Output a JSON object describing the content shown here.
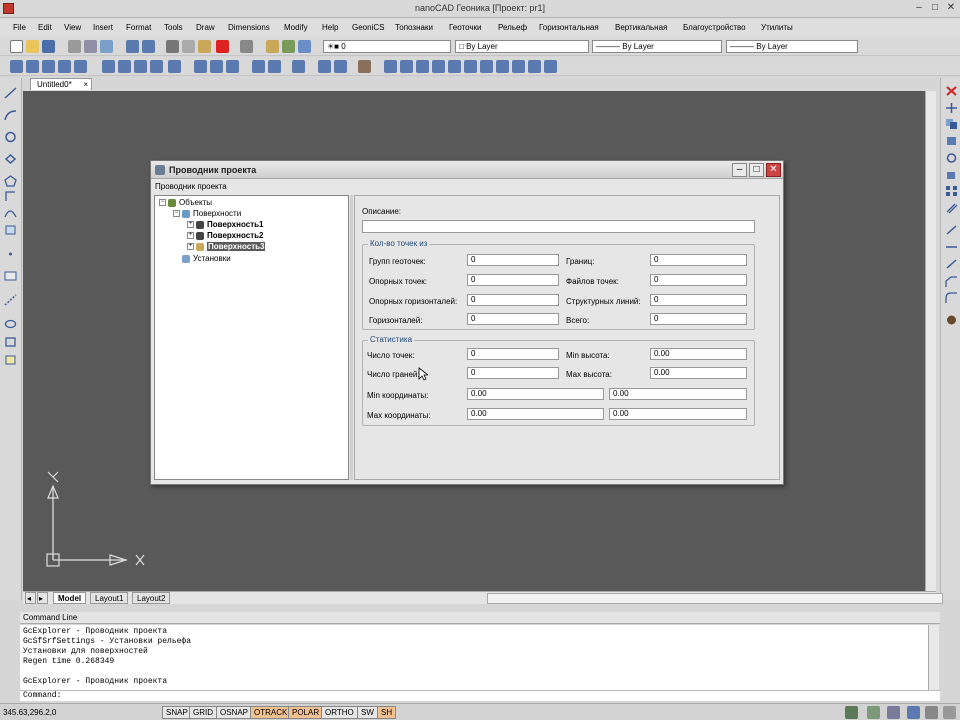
{
  "window": {
    "title": "nanoCAD Геоника [Проект: pr1]",
    "minimize_symbol": "–",
    "maximize_symbol": "□",
    "close_symbol": "✕"
  },
  "menu": [
    "File",
    "Edit",
    "View",
    "Insert",
    "Format",
    "Tools",
    "Draw",
    "Dimensions",
    "Modify",
    "Help",
    "GeoniCS",
    "Топознаки",
    "Геоточки",
    "Рельеф",
    "Горизонтальная",
    "Вертикальная",
    "Благоустройство",
    "Утилиты"
  ],
  "toolbar": {
    "layer_value": "0",
    "color_value": "By Layer",
    "linetype_value": "By Layer",
    "lineweight_value": "By Layer"
  },
  "document_tab": {
    "label": "Untitled0*",
    "close_symbol": "×"
  },
  "dialog": {
    "title": "Проводник проекта",
    "menu_label": "Проводник проекта",
    "tree": {
      "root": "Объекты",
      "group": "Поверхности",
      "items": [
        "Поверхность1",
        "Поверхность2",
        "Поверхность3"
      ],
      "settings": "Установки"
    },
    "description_label": "Описание:",
    "points_group": {
      "title": "Кол-во точек из",
      "rows": [
        {
          "left_label": "Групп геоточек:",
          "left_value": "0",
          "right_label": "Границ:",
          "right_value": "0"
        },
        {
          "left_label": "Опорных точек:",
          "left_value": "0",
          "right_label": "Файлов точек:",
          "right_value": "0"
        },
        {
          "left_label": "Опорных горизонталей:",
          "left_value": "0",
          "right_label": "Структурных линий:",
          "right_value": "0"
        },
        {
          "left_label": "Горизонталей:",
          "left_value": "0",
          "right_label": "Всего:",
          "right_value": "0"
        }
      ]
    },
    "stats_group": {
      "title": "Статистика",
      "rows": [
        {
          "left_label": "Число точек:",
          "left_value": "0",
          "right_label": "Min высота:",
          "right_value": "0.00"
        },
        {
          "left_label": "Число граней:",
          "left_value": "0",
          "right_label": "Max высота:",
          "right_value": "0.00"
        }
      ],
      "min_coords_label": "Min координаты:",
      "min_coords": [
        "0.00",
        "0.00"
      ],
      "max_coords_label": "Max координаты:",
      "max_coords": [
        "0.00",
        "0.00"
      ]
    }
  },
  "layout_tabs": [
    "Model",
    "Layout1",
    "Layout2"
  ],
  "command_line": {
    "title": "Command Line",
    "history": [
      "GcExplorer - Проводник проекта",
      "GcSfSrfSettings - Установки рельефа",
      "Установки для поверхностей",
      "Regen time 0.268349",
      "",
      "GcExplorer - Проводник проекта"
    ],
    "prompt": "Command:"
  },
  "status": {
    "coordinates": "345.63,296.2,0",
    "buttons": [
      {
        "label": "SNAP",
        "on": false
      },
      {
        "label": "GRID",
        "on": false
      },
      {
        "label": "OSNAP",
        "on": false
      },
      {
        "label": "OTRACK",
        "on": true
      },
      {
        "label": "POLAR",
        "on": true
      },
      {
        "label": "ORTHO",
        "on": false
      },
      {
        "label": "SW",
        "on": false
      },
      {
        "label": "SH",
        "on": true
      }
    ]
  },
  "colors": {
    "canvas": "#595959",
    "toggle_on": "#f0c090",
    "tree_selection": "#5a5a5a",
    "group_title": "#204a7a"
  }
}
